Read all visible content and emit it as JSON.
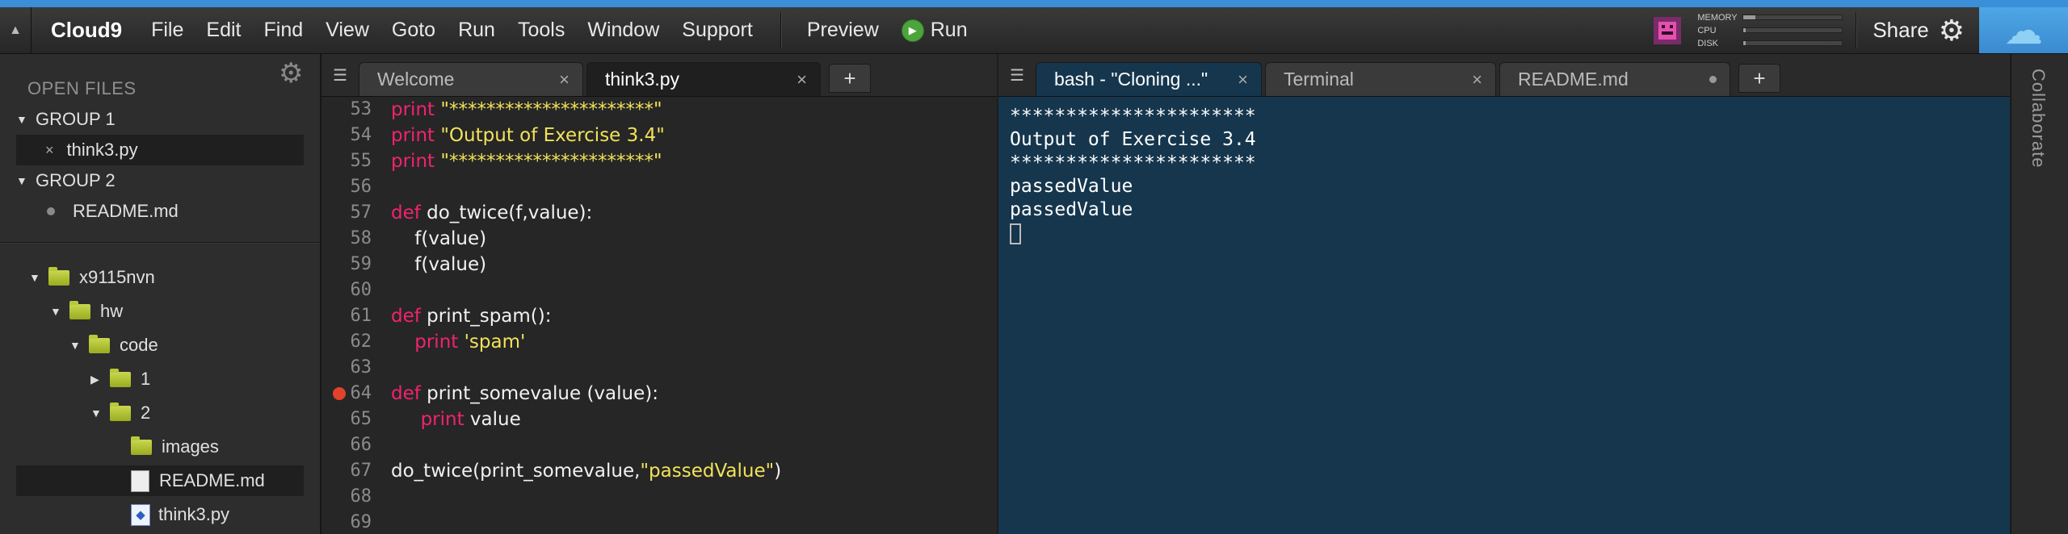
{
  "app": {
    "name": "Cloud9"
  },
  "menu": {
    "items": [
      "File",
      "Edit",
      "Find",
      "View",
      "Goto",
      "Run",
      "Tools",
      "Window",
      "Support"
    ],
    "preview": "Preview",
    "run": "Run"
  },
  "stats": {
    "memory_label": "MEMORY",
    "cpu_label": "CPU",
    "disk_label": "DISK",
    "memory_level": 0.12,
    "cpu_level": 0.02,
    "disk_level": 0.02
  },
  "header_right": {
    "share": "Share"
  },
  "sidebar": {
    "open_files_title": "OPEN FILES",
    "group1": "GROUP 1",
    "group1_file": "think3.py",
    "group2": "GROUP 2",
    "group2_file": "README.md",
    "tree": {
      "root": "x9115nvn",
      "hw": "hw",
      "code": "code",
      "f1": "1",
      "f2": "2",
      "images": "images",
      "readme": "README.md",
      "think3": "think3.py"
    }
  },
  "editor": {
    "tabs": [
      "Welcome",
      "think3.py"
    ],
    "active_tab": "think3.py",
    "breakpoint_line": "64",
    "lines": [
      {
        "n": "53",
        "tokens": [
          {
            "t": "print",
            "c": "kw"
          },
          {
            "t": " "
          },
          {
            "t": "\"**********************\"",
            "c": "str"
          }
        ]
      },
      {
        "n": "54",
        "tokens": [
          {
            "t": "print",
            "c": "kw"
          },
          {
            "t": " "
          },
          {
            "t": "\"Output of Exercise 3.4\"",
            "c": "str"
          }
        ]
      },
      {
        "n": "55",
        "tokens": [
          {
            "t": "print",
            "c": "kw"
          },
          {
            "t": " "
          },
          {
            "t": "\"**********************\"",
            "c": "str"
          }
        ]
      },
      {
        "n": "56",
        "tokens": []
      },
      {
        "n": "57",
        "tokens": [
          {
            "t": "def",
            "c": "kw"
          },
          {
            "t": " do_twice(f,value):"
          }
        ]
      },
      {
        "n": "58",
        "tokens": [
          {
            "t": "    f(value)"
          }
        ]
      },
      {
        "n": "59",
        "tokens": [
          {
            "t": "    f(value)"
          }
        ]
      },
      {
        "n": "60",
        "tokens": []
      },
      {
        "n": "61",
        "tokens": [
          {
            "t": "def",
            "c": "kw"
          },
          {
            "t": " print_spam():"
          }
        ]
      },
      {
        "n": "62",
        "tokens": [
          {
            "t": "    "
          },
          {
            "t": "print",
            "c": "kw"
          },
          {
            "t": " "
          },
          {
            "t": "'spam'",
            "c": "str"
          }
        ]
      },
      {
        "n": "63",
        "tokens": []
      },
      {
        "n": "64",
        "tokens": [
          {
            "t": "def",
            "c": "kw"
          },
          {
            "t": " print_somevalue (value):"
          }
        ]
      },
      {
        "n": "65",
        "tokens": [
          {
            "t": "     "
          },
          {
            "t": "print",
            "c": "kw"
          },
          {
            "t": " value"
          }
        ]
      },
      {
        "n": "66",
        "tokens": []
      },
      {
        "n": "67",
        "tokens": [
          {
            "t": "do_twice(print_somevalue,"
          },
          {
            "t": "\"passedValue\"",
            "c": "str"
          },
          {
            "t": ")"
          }
        ]
      },
      {
        "n": "68",
        "tokens": []
      },
      {
        "n": "69",
        "tokens": []
      }
    ]
  },
  "terminal": {
    "tabs": [
      "bash - \"Cloning ...\"",
      "Terminal",
      "README.md"
    ],
    "active_tab": "bash - \"Cloning ...\"",
    "lines": [
      "**********************",
      "Output of Exercise 3.4",
      "**********************",
      "passedValue",
      "passedValue"
    ]
  },
  "collaborate": {
    "label": "Collaborate"
  },
  "colors": {
    "accent": "#3b8fd8",
    "keyword": "#f2226f",
    "string": "#f1e25a",
    "terminal_bg": "#15364d",
    "folder": "#b8c83a",
    "run_green": "#4ca43c",
    "breakpoint": "#e2422a"
  }
}
